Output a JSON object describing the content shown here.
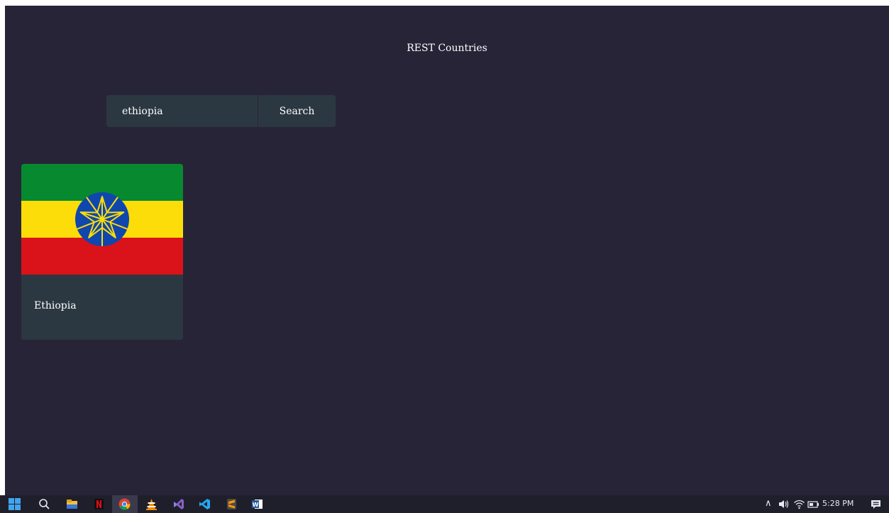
{
  "app": {
    "title": "REST Countries"
  },
  "search": {
    "value": "ethiopia",
    "button_label": "Search"
  },
  "results": [
    {
      "name": "Ethiopia",
      "flag_icon": "flag-of-ethiopia"
    }
  ],
  "taskbar": {
    "apps": [
      "windows-start-icon",
      "search-icon",
      "file-explorer-icon",
      "netflix-icon",
      "chrome-icon",
      "vlc-icon",
      "visual-studio-icon",
      "vscode-icon",
      "sublime-text-icon",
      "word-icon"
    ],
    "clock": "5:28 PM"
  },
  "colors": {
    "background": "#272438",
    "surface": "#2c3841",
    "text": "#ffffff",
    "flag_green": "#078930",
    "flag_yellow": "#fcdd09",
    "flag_red": "#da121a",
    "flag_blue": "#0f47af"
  }
}
